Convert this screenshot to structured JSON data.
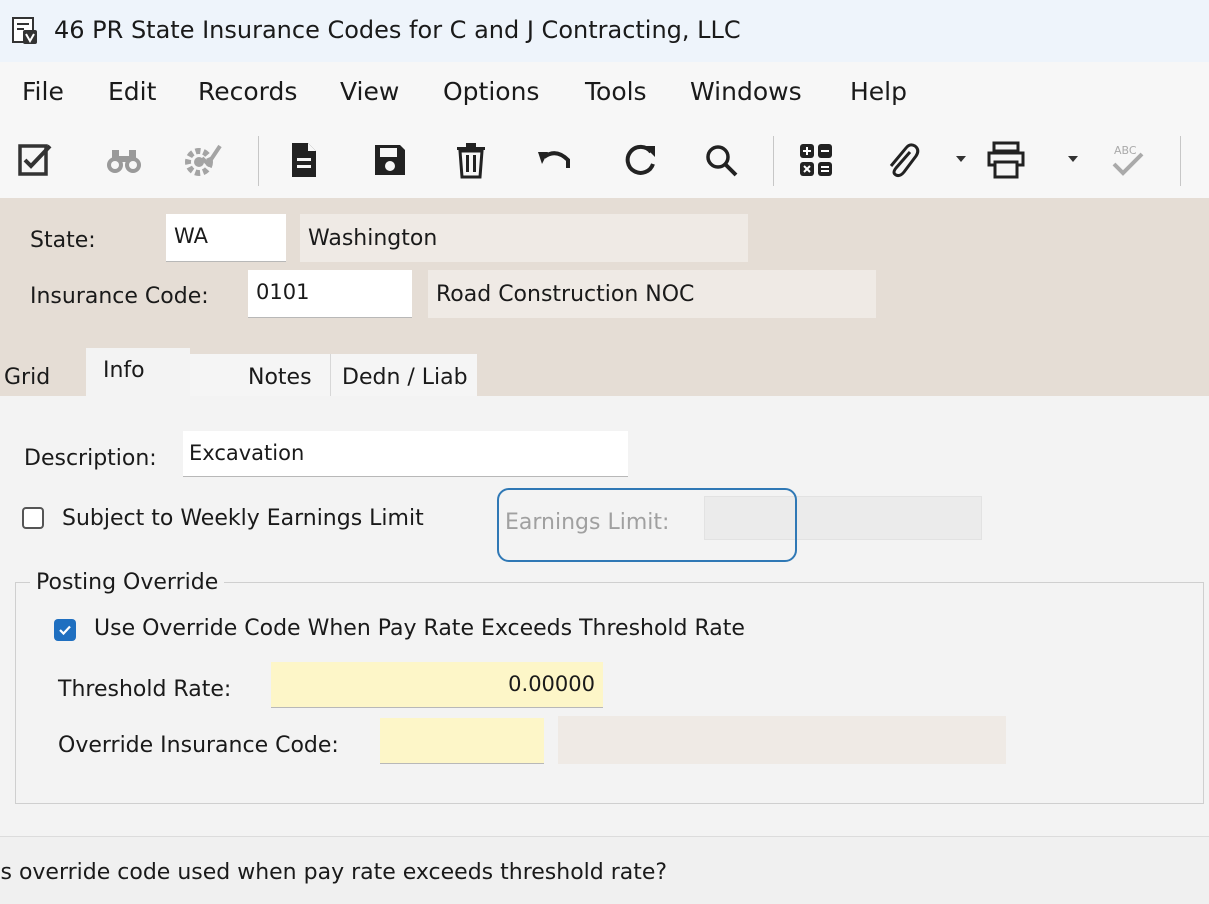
{
  "window": {
    "title": "46 PR State Insurance Codes for C and J Contracting, LLC",
    "icon": "form-icon"
  },
  "menu": [
    "File",
    "Edit",
    "Records",
    "View",
    "Options",
    "Tools",
    "Windows",
    "Help"
  ],
  "toolbar": [
    {
      "name": "edit-checklist-icon",
      "enabled": true
    },
    {
      "name": "binoculars-icon",
      "enabled": false
    },
    {
      "name": "gear-check-icon",
      "enabled": false
    },
    {
      "name": "new-document-icon",
      "enabled": true
    },
    {
      "name": "save-icon",
      "enabled": true
    },
    {
      "name": "delete-trash-icon",
      "enabled": true
    },
    {
      "name": "undo-icon",
      "enabled": true
    },
    {
      "name": "refresh-icon",
      "enabled": true
    },
    {
      "name": "search-icon",
      "enabled": true
    },
    {
      "name": "calculator-icon",
      "enabled": true
    },
    {
      "name": "paperclip-icon",
      "enabled": true
    },
    {
      "name": "printer-icon",
      "enabled": true
    },
    {
      "name": "spell-check-icon",
      "enabled": false
    }
  ],
  "header": {
    "state_label": "State:",
    "state_value": "WA",
    "state_name": "Washington",
    "code_label": "Insurance Code:",
    "code_value": "0101",
    "code_description": "Road Construction NOC"
  },
  "tabs": [
    {
      "label": "Grid",
      "active": false
    },
    {
      "label": "Info",
      "active": true
    },
    {
      "label": "Notes",
      "active": false
    },
    {
      "label": "Dedn / Liab",
      "active": false
    }
  ],
  "info": {
    "description_label": "Description:",
    "description_value": "Excavation",
    "weekly_limit_label": "Subject to Weekly Earnings Limit",
    "weekly_limit_checked": false,
    "earnings_limit_label": "Earnings Limit:",
    "earnings_limit_value": ""
  },
  "posting_override": {
    "legend": "Posting Override",
    "use_override_label": "Use Override Code When Pay Rate Exceeds Threshold Rate",
    "use_override_checked": true,
    "threshold_label": "Threshold Rate:",
    "threshold_value": "0.00000",
    "override_code_label": "Override Insurance Code:",
    "override_code_value": "",
    "override_code_description": ""
  },
  "status_bar": {
    "text": "Is override code used when pay rate exceeds threshold rate?"
  },
  "colors": {
    "accent": "#2f78b5",
    "header_bg": "#e5ddd5",
    "required_field": "#fdf6c8"
  }
}
